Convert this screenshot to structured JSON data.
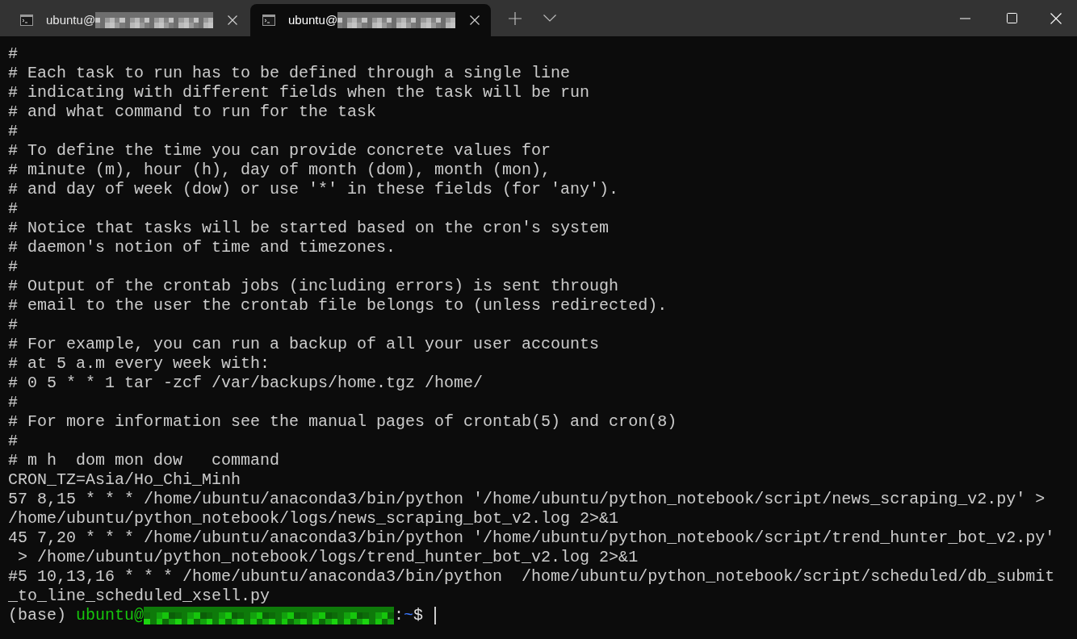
{
  "window": {
    "tabs": [
      {
        "title": "ubuntu@",
        "host_redacted": true,
        "selected": false
      },
      {
        "title": "ubuntu@",
        "host_redacted": true,
        "selected": true
      }
    ]
  },
  "terminal": {
    "lines": [
      "#",
      "# Each task to run has to be defined through a single line",
      "# indicating with different fields when the task will be run",
      "# and what command to run for the task",
      "#",
      "# To define the time you can provide concrete values for",
      "# minute (m), hour (h), day of month (dom), month (mon),",
      "# and day of week (dow) or use '*' in these fields (for 'any').",
      "#",
      "# Notice that tasks will be started based on the cron's system",
      "# daemon's notion of time and timezones.",
      "#",
      "# Output of the crontab jobs (including errors) is sent through",
      "# email to the user the crontab file belongs to (unless redirected).",
      "#",
      "# For example, you can run a backup of all your user accounts",
      "# at 5 a.m every week with:",
      "# 0 5 * * 1 tar -zcf /var/backups/home.tgz /home/",
      "#",
      "# For more information see the manual pages of crontab(5) and cron(8)",
      "#",
      "# m h  dom mon dow   command",
      "CRON_TZ=Asia/Ho_Chi_Minh",
      "57 8,15 * * * /home/ubuntu/anaconda3/bin/python '/home/ubuntu/python_notebook/script/news_scraping_v2.py' >",
      "/home/ubuntu/python_notebook/logs/news_scraping_bot_v2.log 2>&1",
      "45 7,20 * * * /home/ubuntu/anaconda3/bin/python '/home/ubuntu/python_notebook/script/trend_hunter_bot_v2.py'",
      " > /home/ubuntu/python_notebook/logs/trend_hunter_bot_v2.log 2>&1",
      "#5 10,13,16 * * * /home/ubuntu/anaconda3/bin/python  /home/ubuntu/python_notebook/script/scheduled/db_submit",
      "_to_line_scheduled_xsell.py"
    ],
    "prompt": {
      "env": "(base)",
      "user": "ubuntu@",
      "host_redacted": true,
      "separator": ":",
      "path": "~",
      "symbol": "$",
      "cursor": true
    }
  }
}
